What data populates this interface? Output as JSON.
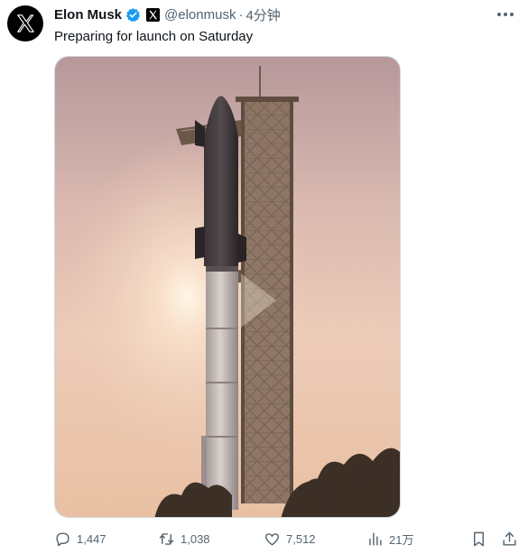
{
  "author": {
    "name": "Elon Musk",
    "handle": "@elonmusk",
    "separator": "·",
    "time": "4分钟",
    "avatar_icon": "x-logo-icon",
    "verified_color": "#1d9bf0"
  },
  "tweet": {
    "text": "Preparing for launch on Saturday",
    "media_alt_icon": "starship-launch-tower-photo"
  },
  "actions": {
    "reply_count": "1,447",
    "retweet_count": "1,038",
    "like_count": "7,512",
    "views_count": "21万"
  },
  "colors": {
    "text_primary": "#0f1419",
    "text_secondary": "#536471",
    "accent": "#1d9bf0"
  }
}
